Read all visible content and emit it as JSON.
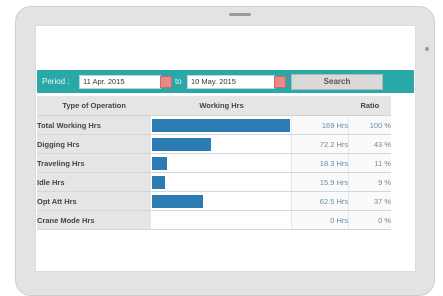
{
  "filter": {
    "period_label": "Period :",
    "from_date": "11 Apr. 2015",
    "to_label": "to",
    "to_date": "10 May. 2015",
    "search_label": "Search",
    "calendar_icon": "calendar-icon"
  },
  "table": {
    "headers": {
      "operation": "Type of Operation",
      "working_hrs": "Working Hrs",
      "hours": "",
      "ratio": "Ratio"
    },
    "rows": [
      {
        "name": "Total Working Hrs",
        "hours_text": "169 Hrs",
        "ratio_text": "100 %",
        "value": 169
      },
      {
        "name": "Digging Hrs",
        "hours_text": "72.2 Hrs",
        "ratio_text": "43 %",
        "value": 72.2
      },
      {
        "name": "Traveling Hrs",
        "hours_text": "18.3 Hrs",
        "ratio_text": "11 %",
        "value": 18.3
      },
      {
        "name": "Idle Hrs",
        "hours_text": "15.9 Hrs",
        "ratio_text": "9 %",
        "value": 15.9
      },
      {
        "name": "Opt Att Hrs",
        "hours_text": "62.5 Hrs",
        "ratio_text": "37 %",
        "value": 62.5
      },
      {
        "name": "Crane Mode Hrs",
        "hours_text": "0 Hrs",
        "ratio_text": "0 %",
        "value": 0
      }
    ],
    "max_value": 169
  },
  "colors": {
    "accent": "#2aa8a8",
    "bar": "#2a7cb3",
    "calendar_button": "#e88a8a"
  }
}
